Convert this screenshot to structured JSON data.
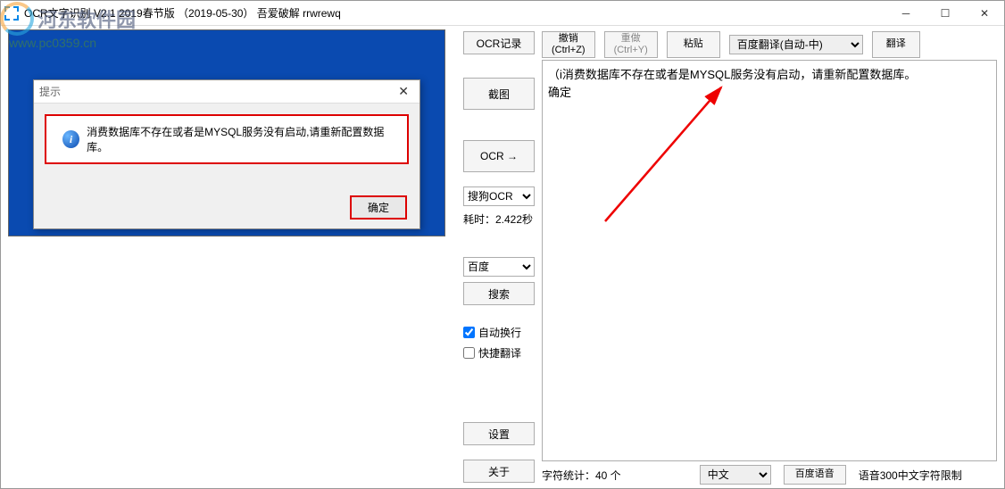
{
  "titlebar": {
    "text": "OCR文字识别 V2.1    2019春节版  （2019-05-30）   吾爱破解 rrwrewq"
  },
  "dialog": {
    "title": "提示",
    "message": "消费数据库不存在或者是MYSQL服务没有启动,请重新配置数据库。",
    "ok_label": "确定"
  },
  "middle": {
    "ocr_record": "OCR记录",
    "screenshot": "截图",
    "ocr": "OCR   →",
    "engine_select": "搜狗OCR",
    "elapsed": "耗时：2.422秒",
    "baidu": "百度",
    "search": "搜索",
    "auto_wrap": "自动换行",
    "quick_translate": "快捷翻译",
    "settings": "设置",
    "about": "关于"
  },
  "toolbar": {
    "undo_line1": "撤销",
    "undo_line2": "(Ctrl+Z)",
    "redo_line1": "重做",
    "redo_line2": "(Ctrl+Y)",
    "paste": "粘贴",
    "translator_select": "百度翻译(自动-中)",
    "translate": "翻译"
  },
  "text_area": {
    "line1": "（i消费数据库不存在或者是MYSQL服务没有启动，请重新配置数据库。",
    "line2": "确定"
  },
  "bottom": {
    "char_count": "字符统计：40 个",
    "lang_select": "中文",
    "voice_btn": "百度语音",
    "voice_limit": "语音300中文字符限制"
  },
  "watermark": {
    "name": "河东软件园",
    "url": "www.pc0359.cn"
  }
}
